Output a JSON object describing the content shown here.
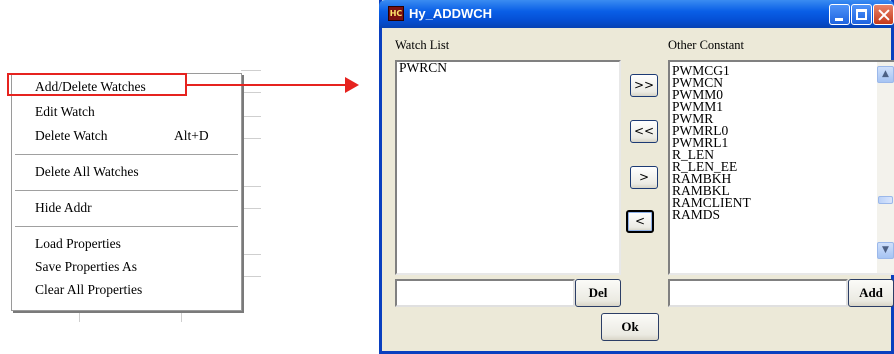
{
  "context_menu": {
    "sections": [
      [
        {
          "label": "Add/Delete Watches",
          "accel": ""
        },
        {
          "label": "Edit Watch",
          "accel": ""
        },
        {
          "label": "Delete Watch",
          "accel": "Alt+D"
        }
      ],
      [
        {
          "label": "Delete All Watches",
          "accel": ""
        }
      ],
      [
        {
          "label": "Hide Addr",
          "accel": ""
        }
      ],
      [
        {
          "label": "Load Properties",
          "accel": ""
        },
        {
          "label": "Save Properties As",
          "accel": ""
        },
        {
          "label": "Clear All Properties",
          "accel": ""
        }
      ]
    ]
  },
  "annotation": {
    "color": "#e6231f"
  },
  "dialog": {
    "title": "Hy_ADDWCH",
    "icon_text": "HC",
    "watch_list": {
      "label": "Watch List",
      "items": [
        "PWRCN"
      ],
      "input_value": "",
      "del_label": "Del"
    },
    "other_constant": {
      "label": "Other Constant",
      "items": [
        "PWMCG1",
        "PWMCN",
        "PWMM0",
        "PWMM1",
        "PWMR",
        "PWMRL0",
        "PWMRL1",
        "R_LEN",
        "R_LEN_EE",
        "RAMBKH",
        "RAMBKL",
        "RAMCLIENT",
        "RAMDS"
      ],
      "input_value": "",
      "add_label": "Add"
    },
    "move_buttons": [
      ">>",
      "<<",
      ">",
      "<"
    ],
    "ok_label": "Ok",
    "colors": {
      "title_bar": "#0550d6",
      "face": "#ece9d8"
    }
  }
}
